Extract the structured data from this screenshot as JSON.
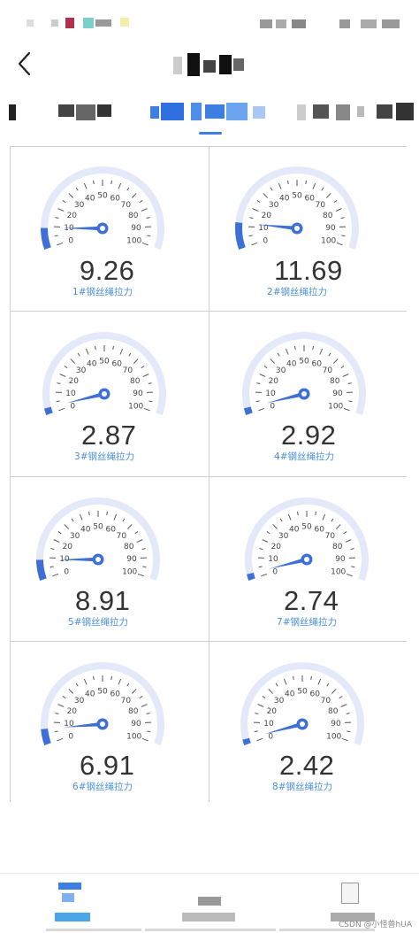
{
  "gauges": [
    {
      "value": 9.26,
      "value_text": "9.26",
      "label": "1#钢丝绳拉力"
    },
    {
      "value": 11.69,
      "value_text": "11.69",
      "label": "2#钢丝绳拉力"
    },
    {
      "value": 2.87,
      "value_text": "2.87",
      "label": "3#钢丝绳拉力"
    },
    {
      "value": 2.92,
      "value_text": "2.92",
      "label": "4#钢丝绳拉力"
    },
    {
      "value": 8.91,
      "value_text": "8.91",
      "label": "5#钢丝绳拉力"
    },
    {
      "value": 2.74,
      "value_text": "2.74",
      "label": "7#钢丝绳拉力"
    },
    {
      "value": 6.91,
      "value_text": "6.91",
      "label": "6#钢丝绳拉力"
    },
    {
      "value": 2.42,
      "value_text": "2.42",
      "label": "8#钢丝绳拉力"
    }
  ],
  "gauge_scale": {
    "min": 0,
    "max": 100,
    "tick_labels": [
      "0",
      "10",
      "20",
      "30",
      "40",
      "50",
      "60",
      "70",
      "80",
      "90",
      "100"
    ]
  },
  "colors": {
    "accent": "#3d6fd6",
    "track": "#e3e9f8",
    "label": "#4a90d9",
    "indicator": "#3d7fe0"
  },
  "icons": {
    "back": "chevron-left-icon"
  },
  "watermark": "CSDN @小怪兽hUA"
}
